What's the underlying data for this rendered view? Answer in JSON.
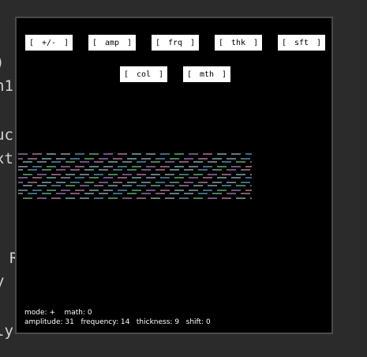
{
  "background_code": [
    ")",
    "h1",
    "uc",
    "xt",
    "R",
    "y",
    "ly"
  ],
  "buttons": [
    {
      "label": "+/-"
    },
    {
      "label": "amp"
    },
    {
      "label": "frq"
    },
    {
      "label": "thk"
    },
    {
      "label": "sft"
    },
    {
      "label": "col"
    },
    {
      "label": "mth"
    }
  ],
  "status": {
    "mode_label": "mode:",
    "mode_value": "+",
    "math_label": "math:",
    "math_value": "0",
    "amplitude_label": "amplitude:",
    "amplitude_value": "31",
    "frequency_label": "frequency:",
    "frequency_value": "14",
    "thickness_label": "thickness:",
    "thickness_value": "9",
    "shift_label": "shift:",
    "shift_value": "0"
  },
  "colors": {
    "wave_palette": [
      "#7fd3ff",
      "#8fffb0",
      "#d7a8ff",
      "#ffb3e6",
      "#b8ffff",
      "#cfe9ff"
    ]
  }
}
